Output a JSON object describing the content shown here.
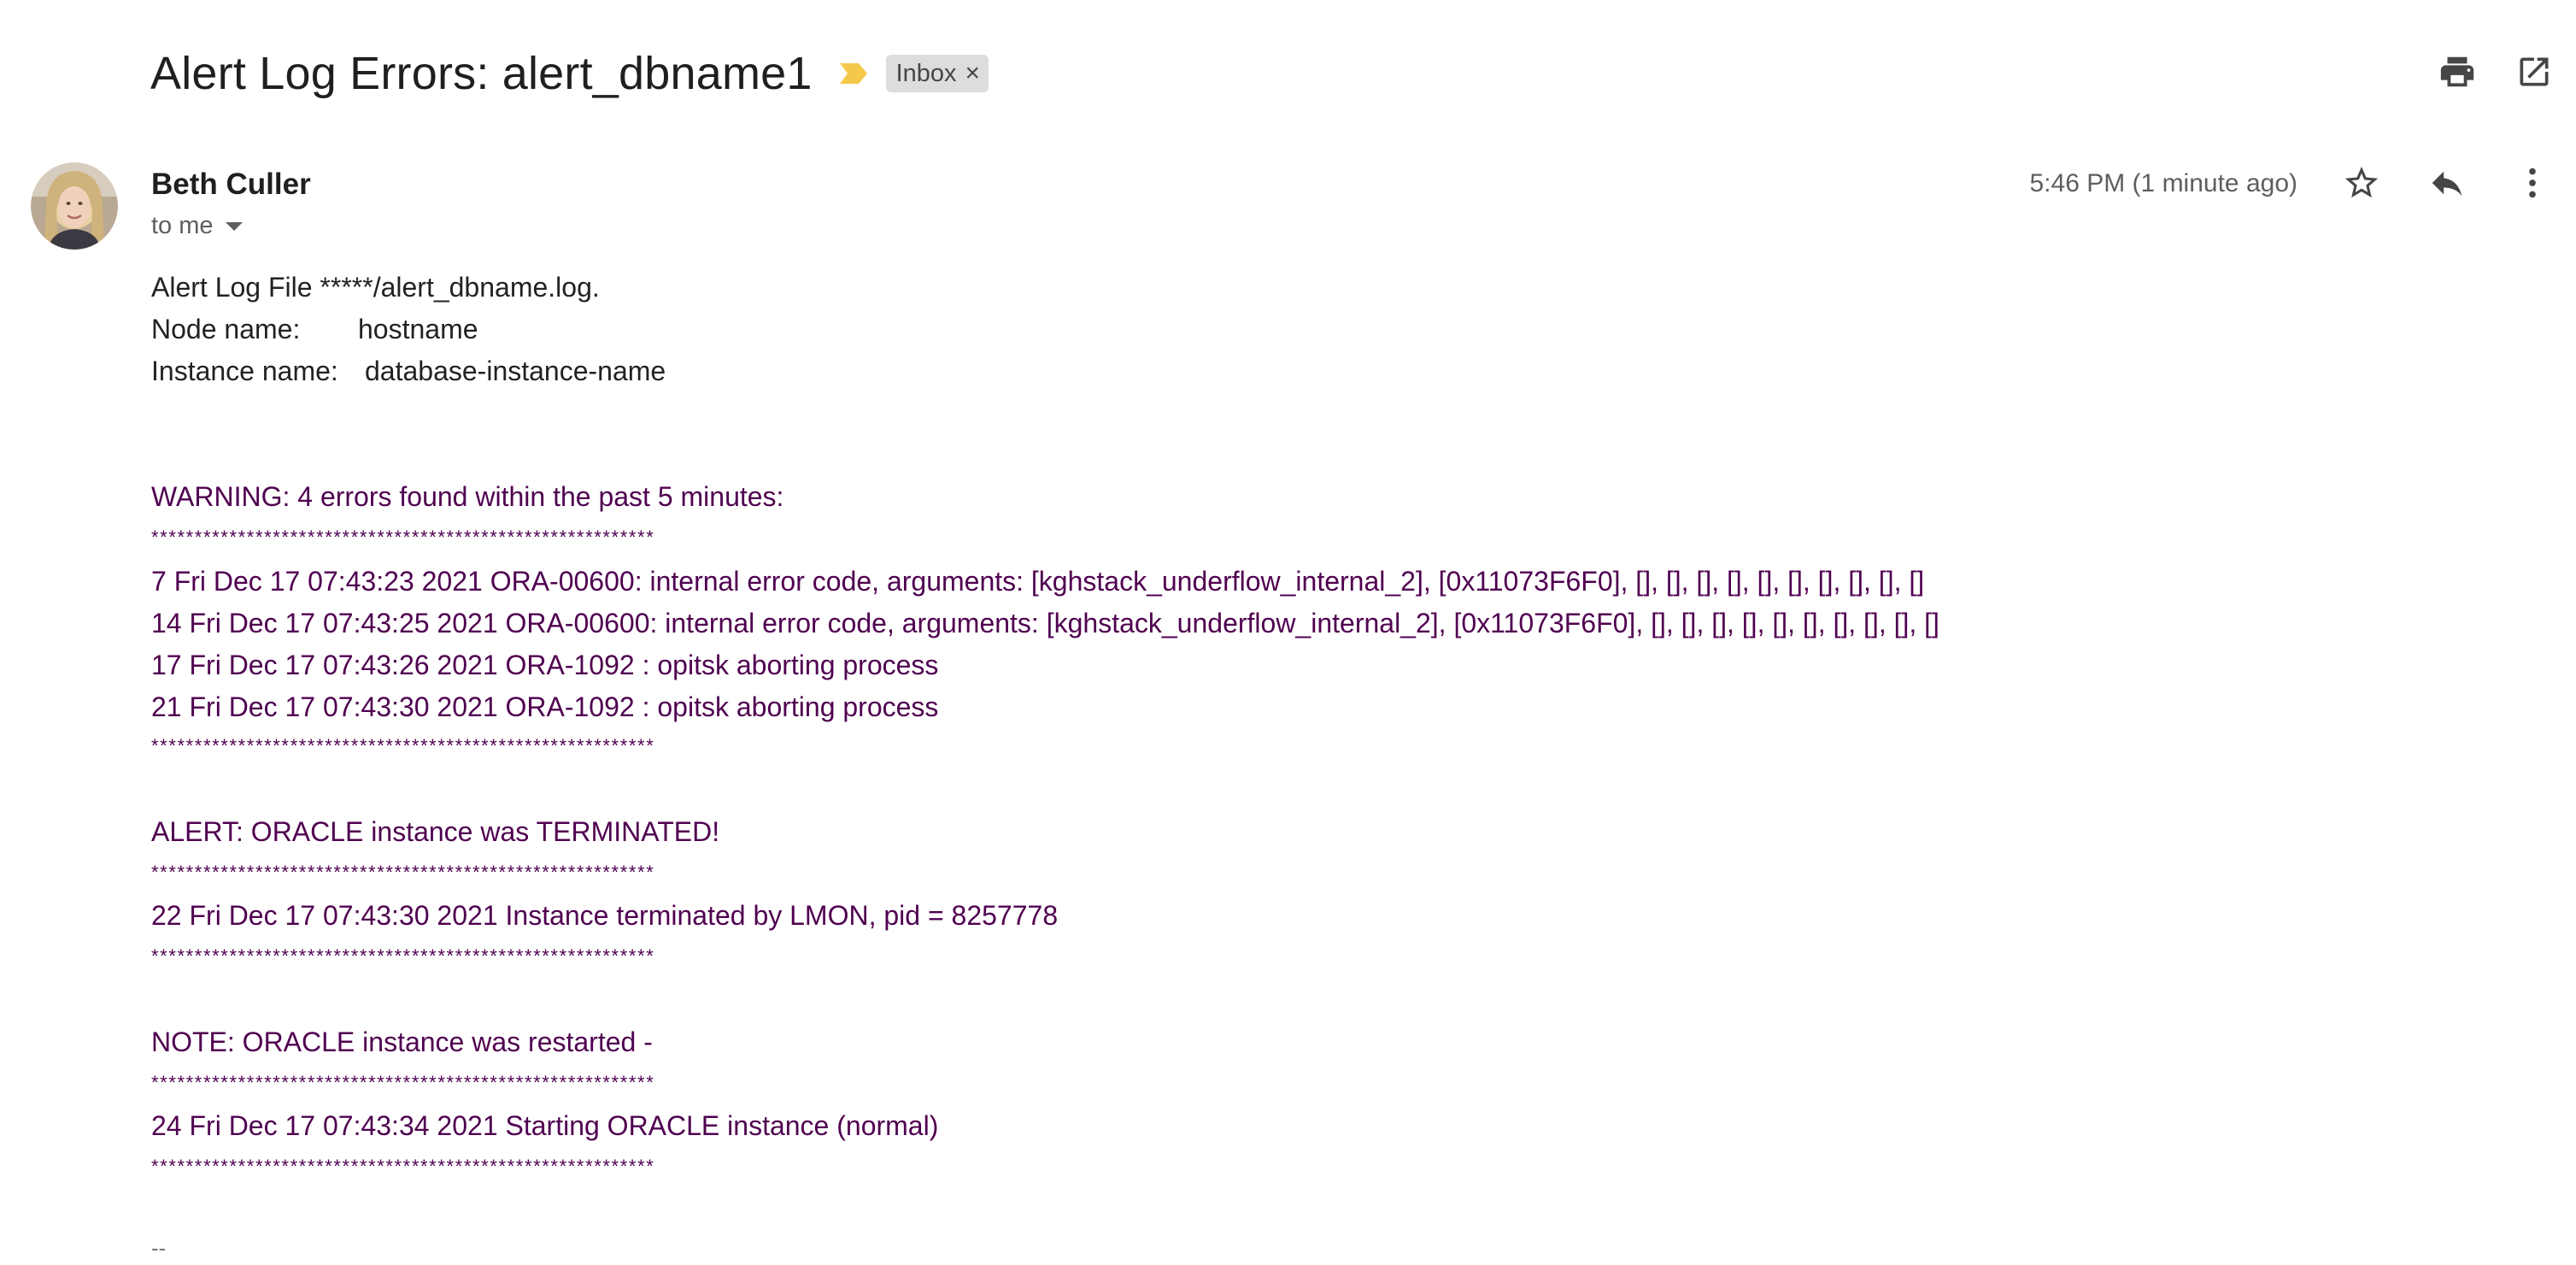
{
  "subject": {
    "title": "Alert Log Errors: alert_dbname1",
    "label_chip": "Inbox",
    "label_remove": "×"
  },
  "toolbar": {
    "print_icon": "print-icon",
    "open_new_window_icon": "open-in-new-window-icon"
  },
  "sender": {
    "name": "Beth Culler",
    "recipient": "to me",
    "timestamp": "5:46 PM (1 minute ago)"
  },
  "actions": {
    "star_icon": "star-icon",
    "reply_icon": "reply-icon",
    "more_icon": "more-vertical-icon"
  },
  "body": {
    "header_lines": {
      "file": "Alert Log File *****/alert_dbname.log.",
      "node_label": "Node name:",
      "node_value": "hostname",
      "instance_label": "Instance name:",
      "instance_value": "database-instance-name"
    },
    "warning_heading": "WARNING: 4 errors found within the past 5 minutes:",
    "separator": "**********************************************************",
    "errors": [
      "7 Fri Dec 17 07:43:23 2021 ORA-00600: internal error code, arguments: [kghstack_underflow_internal_2], [0x11073F6F0], [], [], [], [], [], [], [], [], [], []",
      "14 Fri Dec 17 07:43:25 2021 ORA-00600: internal error code, arguments: [kghstack_underflow_internal_2], [0x11073F6F0], [], [], [], [], [], [], [], [], [], []",
      "17 Fri Dec 17 07:43:26 2021 ORA-1092 : opitsk aborting process",
      "21 Fri Dec 17 07:43:30 2021 ORA-1092 : opitsk aborting process"
    ],
    "alert_heading": "ALERT: ORACLE instance was TERMINATED!",
    "alert_line": "22 Fri Dec 17 07:43:30 2021 Instance terminated by LMON, pid = 8257778",
    "note_heading": "NOTE: ORACLE instance was restarted -",
    "note_line": "24 Fri Dec 17 07:43:34 2021 Starting ORACLE instance (normal)",
    "signature_dash": "--"
  },
  "colors": {
    "quoted_purple": "#500050",
    "label_yellow": "#f4c84a",
    "chip_bg": "#dddddd"
  }
}
